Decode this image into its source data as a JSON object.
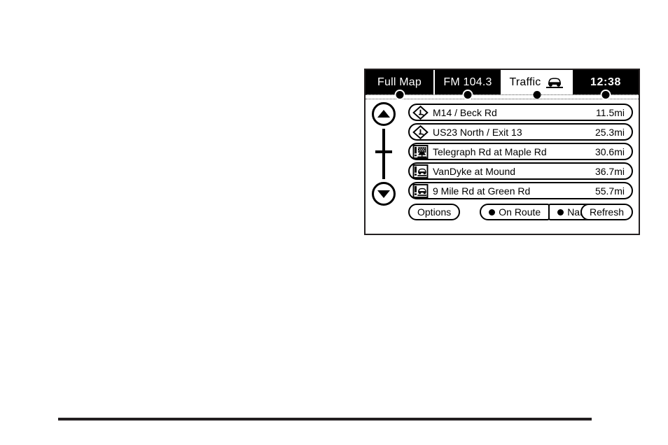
{
  "device": {
    "name": "navigation-radio-traffic-screen"
  },
  "tabs": [
    {
      "label": "Full Map",
      "name": "tab-full-map",
      "active": false
    },
    {
      "label": "FM 104.3",
      "name": "tab-fm-radio",
      "active": false
    },
    {
      "label": "Traffic",
      "name": "tab-traffic",
      "active": true,
      "icon": "car-icon"
    },
    {
      "label": "12:38",
      "name": "tab-clock",
      "active": false
    }
  ],
  "scroll": {
    "up_label": "scroll-up",
    "down_label": "scroll-down"
  },
  "list": {
    "items": [
      {
        "icon": "incident-diamond-icon",
        "label": "M14 / Beck Rd",
        "distance": "11.5mi"
      },
      {
        "icon": "incident-diamond-icon",
        "label": "US23 North / Exit 13",
        "distance": "25.3mi"
      },
      {
        "icon": "incident-weather-icon",
        "label": "Telegraph Rd at Maple Rd",
        "distance": "30.6mi"
      },
      {
        "icon": "incident-crash-icon",
        "label": "VanDyke at Mound",
        "distance": "36.7mi"
      },
      {
        "icon": "incident-crash-icon",
        "label": "9 Mile Rd at Green Rd",
        "distance": "55.7mi"
      }
    ]
  },
  "buttons": {
    "options": "Options",
    "on_route": "On Route",
    "name": "Name",
    "refresh": "Refresh"
  },
  "colors": {
    "frame": "#231f20",
    "tab_inactive_bg": "#000000",
    "tab_inactive_text": "#ffffff",
    "tab_active_bg": "#ffffff",
    "tab_active_text": "#000000",
    "outline": "#000000"
  }
}
